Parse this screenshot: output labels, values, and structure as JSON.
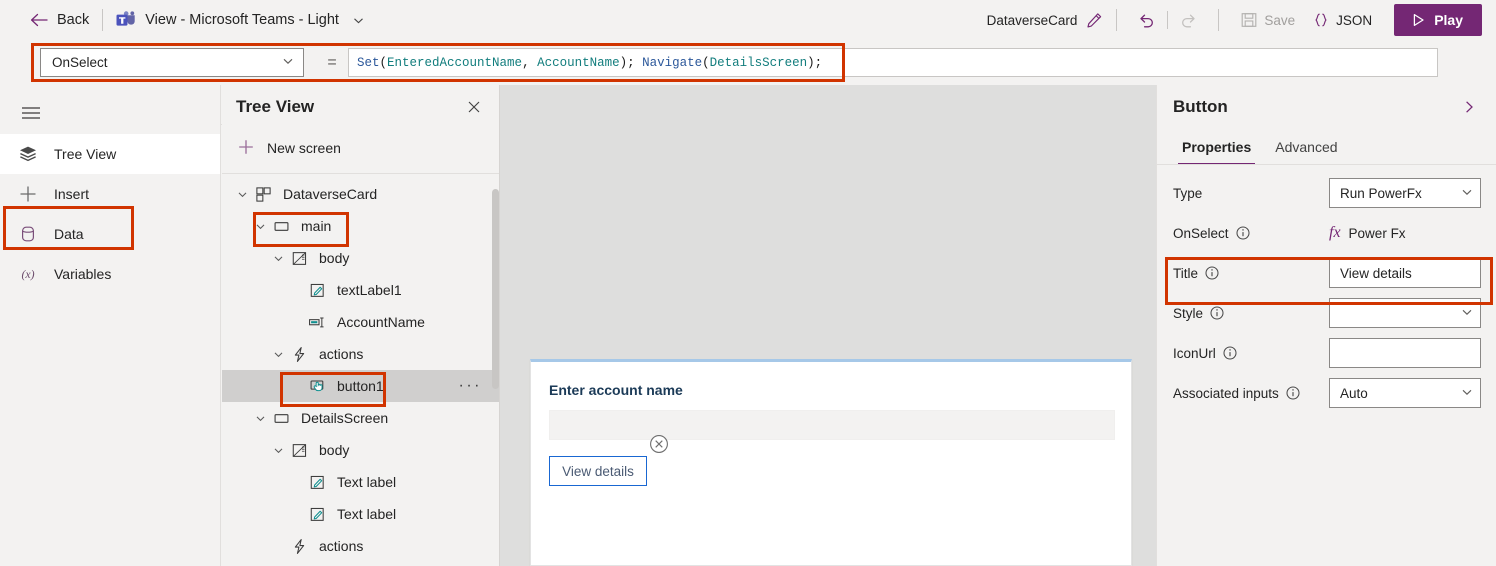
{
  "topbar": {
    "back_label": "Back",
    "app_label": "View - Microsoft Teams - Light",
    "card_name": "DataverseCard",
    "save_label": "Save",
    "json_label": "JSON",
    "play_label": "Play",
    "icons": {
      "back": "back-arrow-icon",
      "teams": "microsoft-teams-icon",
      "chevron": "chevron-down-icon",
      "pencil": "pencil-edit-icon",
      "undo": "undo-icon",
      "redo": "redo-icon",
      "save": "save-disk-icon",
      "json": "json-braces-icon",
      "play": "play-triangle-icon"
    },
    "accent": "#742774"
  },
  "formula_bar": {
    "property": "OnSelect",
    "equals": "=",
    "tokens": [
      {
        "t": "Set",
        "k": "fn"
      },
      {
        "t": "(",
        "k": "punc"
      },
      {
        "t": "EnteredAccountName",
        "k": "var"
      },
      {
        "t": ", ",
        "k": "punc"
      },
      {
        "t": "AccountName",
        "k": "var"
      },
      {
        "t": "); ",
        "k": "punc"
      },
      {
        "t": "Navigate",
        "k": "fn"
      },
      {
        "t": "(",
        "k": "punc"
      },
      {
        "t": "DetailsScreen",
        "k": "var"
      },
      {
        "t": ");",
        "k": "punc"
      }
    ],
    "full_text": "Set(EnteredAccountName, AccountName); Navigate(DetailsScreen);",
    "highlight_color": "#d13400"
  },
  "rail": {
    "menu_icon": "hamburger-menu-icon",
    "items": [
      {
        "label": "Tree View",
        "icon": "layers-icon",
        "active": true
      },
      {
        "label": "Insert",
        "icon": "plus-icon",
        "active": false
      },
      {
        "label": "Data",
        "icon": "database-icon",
        "active": false
      },
      {
        "label": "Variables",
        "icon": "variables-x-icon",
        "active": false
      }
    ]
  },
  "tree": {
    "title": "Tree View",
    "close_icon": "close-icon",
    "new_screen_label": "New screen",
    "nodes": [
      {
        "label": "DataverseCard",
        "indent": 0,
        "twisty": "down",
        "icon": "screen-layout-icon",
        "selected": false
      },
      {
        "label": "main",
        "indent": 1,
        "twisty": "down",
        "icon": "rectangle-icon",
        "selected": false
      },
      {
        "label": "body",
        "indent": 2,
        "twisty": "down",
        "icon": "body-container-icon",
        "selected": false
      },
      {
        "label": "textLabel1",
        "indent": 3,
        "twisty": "none",
        "icon": "text-label-icon",
        "selected": false
      },
      {
        "label": "AccountName",
        "indent": 3,
        "twisty": "none",
        "icon": "text-input-icon",
        "selected": false
      },
      {
        "label": "actions",
        "indent": 2,
        "twisty": "down",
        "icon": "lightning-icon",
        "selected": false
      },
      {
        "label": "button1",
        "indent": 3,
        "twisty": "none",
        "icon": "button-cursor-icon",
        "selected": true,
        "ellipsis": "···"
      },
      {
        "label": "DetailsScreen",
        "indent": 1,
        "twisty": "down",
        "icon": "rectangle-icon",
        "selected": false
      },
      {
        "label": "body",
        "indent": 2,
        "twisty": "down",
        "icon": "body-container-icon",
        "selected": false
      },
      {
        "label": "Text label",
        "indent": 3,
        "twisty": "none",
        "icon": "text-label-icon",
        "selected": false
      },
      {
        "label": "Text label",
        "indent": 3,
        "twisty": "none",
        "icon": "text-label-icon",
        "selected": false
      },
      {
        "label": "actions",
        "indent": 2,
        "twisty": "none",
        "icon": "lightning-icon",
        "selected": false
      }
    ]
  },
  "canvas": {
    "card": {
      "label": "Enter account name",
      "input_value": "",
      "button_label": "View details",
      "delete_handle_icon": "delete-circle-x-icon"
    }
  },
  "properties": {
    "title": "Button",
    "collapse_icon": "chevron-right-icon",
    "tabs": [
      {
        "label": "Properties",
        "active": true
      },
      {
        "label": "Advanced",
        "active": false
      }
    ],
    "rows": [
      {
        "label": "Type",
        "info": false,
        "control": "select",
        "value": "Run PowerFx"
      },
      {
        "label": "OnSelect",
        "info": true,
        "control": "fx",
        "value": "Power Fx"
      },
      {
        "label": "Title",
        "info": true,
        "control": "input",
        "value": "View details",
        "highlighted": true
      },
      {
        "label": "Style",
        "info": true,
        "control": "select",
        "value": ""
      },
      {
        "label": "IconUrl",
        "info": true,
        "control": "input",
        "value": ""
      },
      {
        "label": "Associated inputs",
        "info": true,
        "control": "select",
        "value": "Auto"
      }
    ]
  }
}
